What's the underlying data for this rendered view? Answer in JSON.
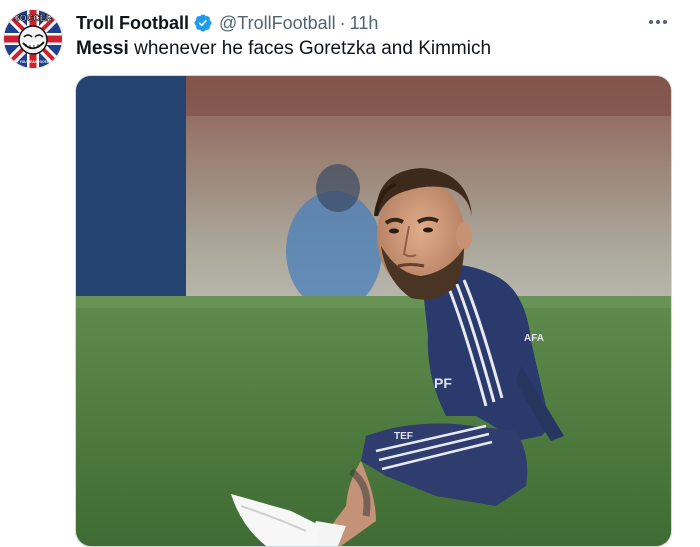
{
  "account": {
    "display_name": "Troll Football",
    "handle": "@TrollFootball",
    "separator": "·",
    "time": "11h",
    "avatar_text_top": "SOCCER",
    "avatar_text_bottom": "DON'T YOU MEAN FOOTBALL?"
  },
  "tweet": {
    "bold_word": "Messi",
    "text_rest": " whenever he faces Goretzka and Kimmich"
  },
  "media": {
    "shirt_text_top": "AFA",
    "shirt_text_mid": "PF",
    "shorts_text": "TEF"
  },
  "colors": {
    "verified_blue": "#1d9bf0",
    "secondary_text": "#536471",
    "pitch_green": "#4a7b3e",
    "jersey_navy": "#2a3a6c"
  },
  "icons": {
    "verified": "verified-badge-icon",
    "more": "more-options-icon"
  }
}
